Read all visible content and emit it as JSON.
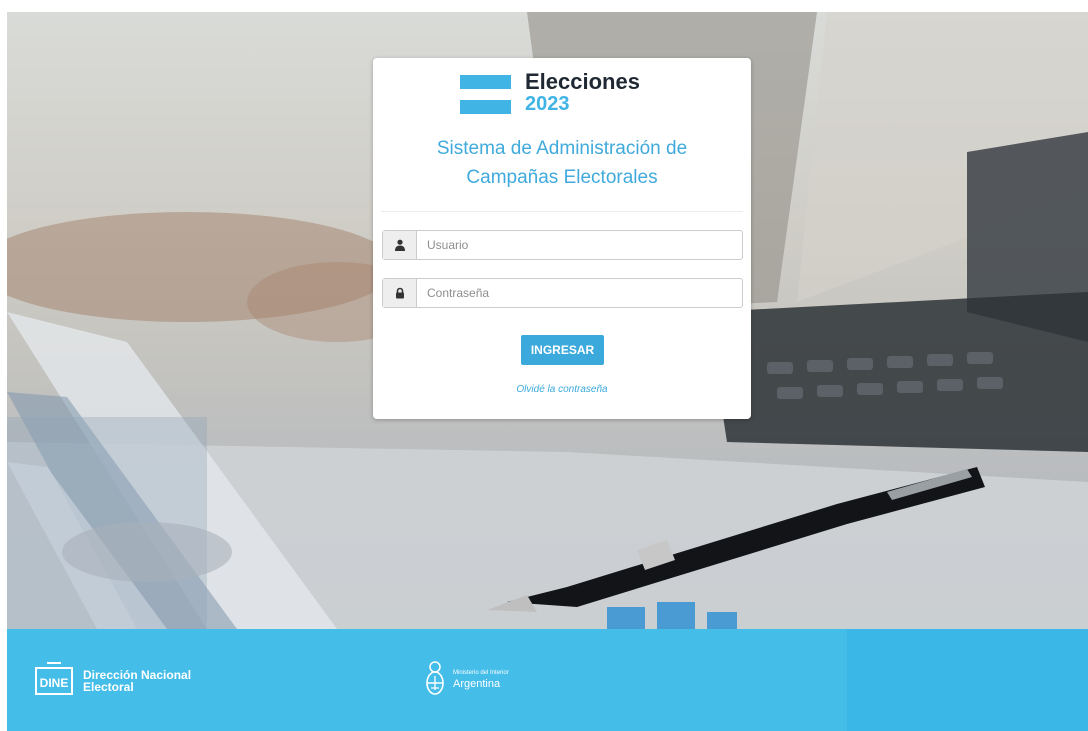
{
  "logo": {
    "title": "Elecciones",
    "year": "2023"
  },
  "system_title": "Sistema de Administración de Campañas Electorales",
  "form": {
    "username_placeholder": "Usuario",
    "password_placeholder": "Contraseña",
    "submit_label": "INGRESAR",
    "forgot_link": "Olvidé la contraseña"
  },
  "footer": {
    "dine_abbrev": "DINE",
    "dine_line1": "Dirección Nacional",
    "dine_line2": "Electoral",
    "ministerio_line1": "Ministerio del Interior",
    "ministerio_line2": "Argentina"
  },
  "colors": {
    "accent": "#41b4e6",
    "footer": "#44bde9",
    "button": "#3ba9dc"
  },
  "icons": {
    "username": "user-icon",
    "password": "lock-icon",
    "footer_seal": "argentina-coat-of-arms-icon"
  }
}
